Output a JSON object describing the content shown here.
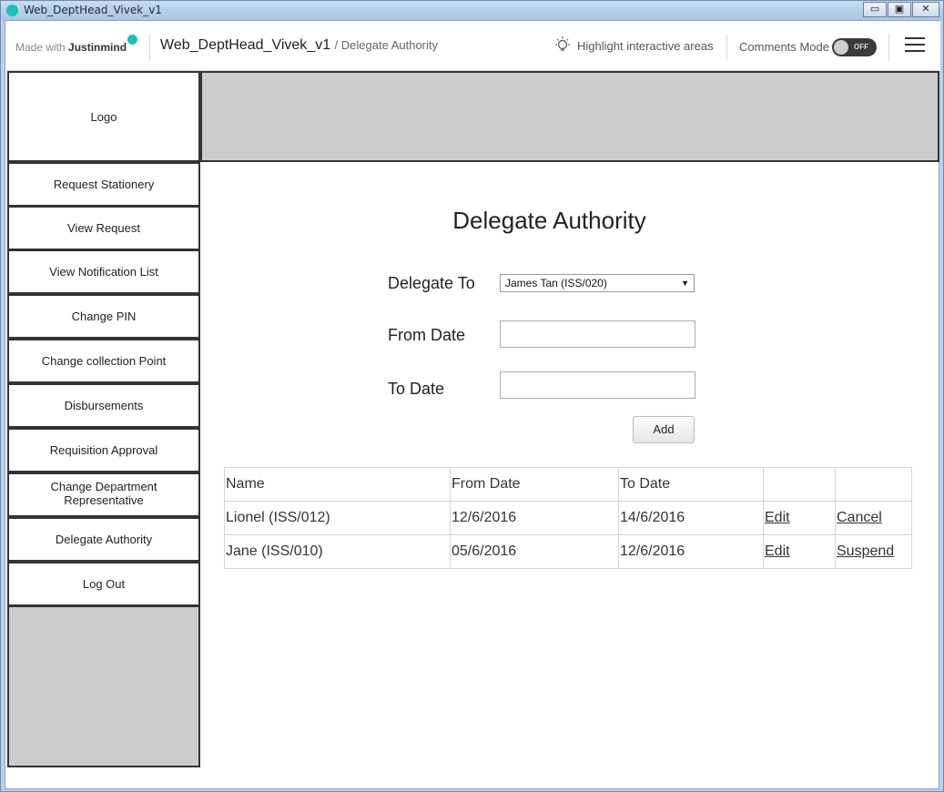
{
  "window": {
    "title": "Web_DeptHead_Vivek_v1",
    "buttons": {
      "minimize": "▭",
      "restore": "▣",
      "close": "✕"
    }
  },
  "header": {
    "made_with": "Made with",
    "brand": "Justinmind",
    "project": "Web_DeptHead_Vivek_v1",
    "page_path": "/ Delegate Authority",
    "highlight_label": "Highlight interactive areas",
    "comments_label": "Comments Mode",
    "comments_toggle": "OFF"
  },
  "sidebar": {
    "logo": "Logo",
    "items": [
      {
        "label": "Request Stationery"
      },
      {
        "label": "View Request"
      },
      {
        "label": "View Notification List"
      },
      {
        "label": "Change PIN"
      },
      {
        "label": "Change collection Point"
      },
      {
        "label": "Disbursements"
      },
      {
        "label": "Requisition Approval"
      },
      {
        "label": "Change Department Representative"
      },
      {
        "label": "Delegate Authority"
      },
      {
        "label": "Log Out"
      }
    ]
  },
  "main": {
    "title": "Delegate Authority",
    "form": {
      "delegate_to_label": "Delegate To",
      "delegate_to_value": "James Tan (ISS/020)",
      "from_date_label": "From Date",
      "from_date_value": "",
      "to_date_label": "To Date",
      "to_date_value": "",
      "add_button": "Add"
    },
    "table": {
      "headers": [
        "Name",
        "From Date",
        "To Date",
        "",
        ""
      ],
      "rows": [
        {
          "name": "Lionel (ISS/012)",
          "from": "12/6/2016",
          "to": "14/6/2016",
          "action1": "Edit",
          "action2": "Cancel"
        },
        {
          "name": "Jane (ISS/010)",
          "from": "05/6/2016",
          "to": "12/6/2016",
          "action1": "Edit",
          "action2": "Suspend"
        }
      ]
    }
  },
  "colors": {
    "accent": "#19c1b8",
    "placeholder_gray": "#cccccc",
    "border_dark": "#333333"
  }
}
